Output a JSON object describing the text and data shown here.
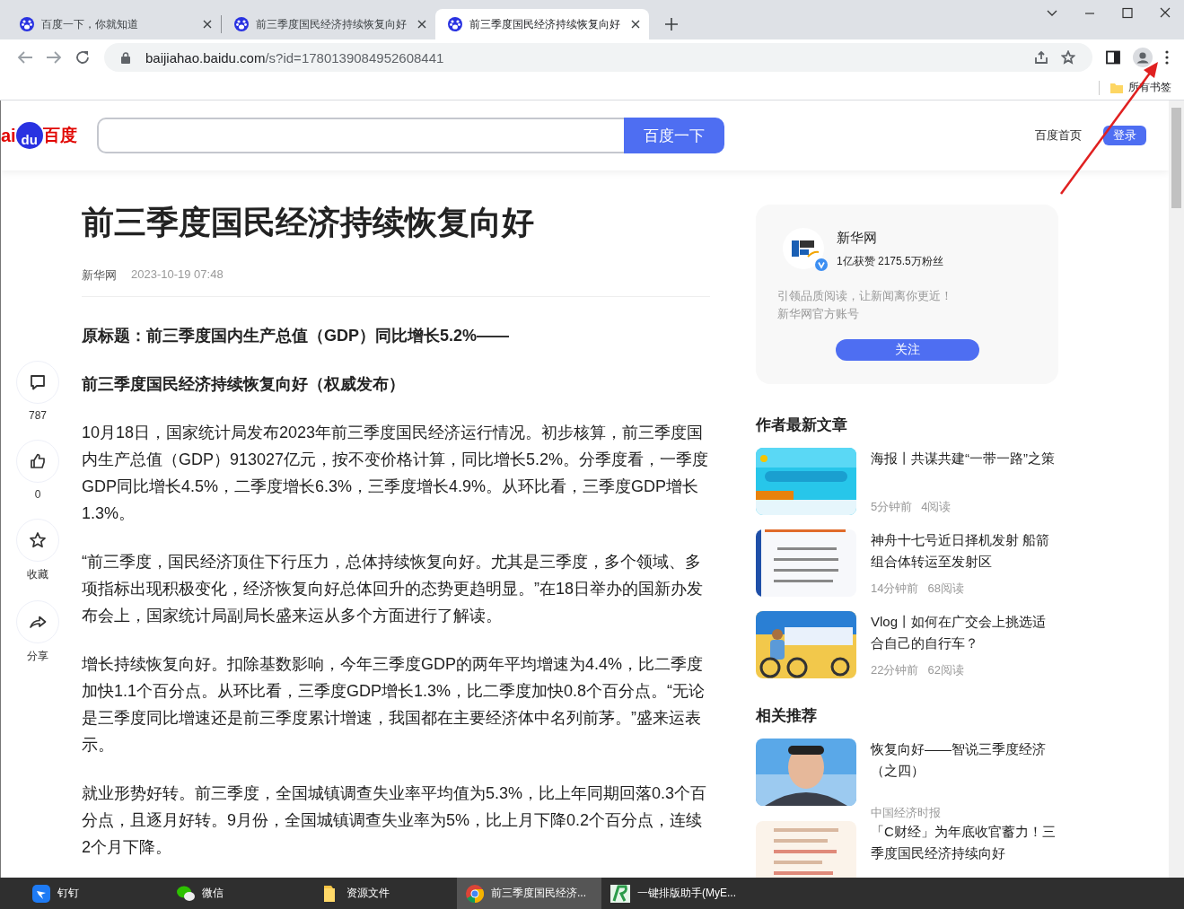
{
  "tabs": [
    {
      "title": "百度一下，你就知道",
      "selected": false
    },
    {
      "title": "前三季度国民经济持续恢复向好",
      "selected": false
    },
    {
      "title": "前三季度国民经济持续恢复向好",
      "selected": true
    }
  ],
  "address": {
    "host": "baijiahao.baidu.com",
    "path": "/s?id=1780139084952608441"
  },
  "bookmarks": {
    "label": "所有书签"
  },
  "header": {
    "logo": {
      "left": "ai",
      "paw": "du",
      "right": "百度"
    },
    "search_button": "百度一下",
    "home_link": "百度首页",
    "login_button": "登录"
  },
  "actions": [
    {
      "kind": "comment",
      "label": "787"
    },
    {
      "kind": "like",
      "label": "0"
    },
    {
      "kind": "favorite",
      "label": "收藏"
    },
    {
      "kind": "share",
      "label": "分享"
    }
  ],
  "article": {
    "title": "前三季度国民经济持续恢复向好",
    "source": "新华网",
    "date": "2023-10-19 07:48",
    "paragraphs": [
      {
        "kind": "heading",
        "text": "原标题：前三季度国内生产总值（GDP）同比增长5.2%——"
      },
      {
        "kind": "heading",
        "text": "前三季度国民经济持续恢复向好（权威发布）"
      },
      {
        "kind": "body",
        "text": "10月18日，国家统计局发布2023年前三季度国民经济运行情况。初步核算，前三季度国内生产总值（GDP）913027亿元，按不变价格计算，同比增长5.2%。分季度看，一季度GDP同比增长4.5%，二季度增长6.3%，三季度增长4.9%。从环比看，三季度GDP增长1.3%。"
      },
      {
        "kind": "body",
        "text": "“前三季度，国民经济顶住下行压力，总体持续恢复向好。尤其是三季度，多个领域、多项指标出现积极变化，经济恢复向好总体回升的态势更趋明显。”在18日举办的国新办发布会上，国家统计局副局长盛来运从多个方面进行了解读。"
      },
      {
        "kind": "body",
        "text": "增长持续恢复向好。扣除基数影响，今年三季度GDP的两年平均增速为4.4%，比二季度加快1.1个百分点。从环比看，三季度GDP增长1.3%，比二季度加快0.8个百分点。“无论是三季度同比增速还是前三季度累计增速，我国都在主要经济体中名列前茅。”盛来运表示。"
      },
      {
        "kind": "body",
        "text": "就业形势好转。前三季度，全国城镇调查失业率平均值为5.3%，比上年同期回落0.3个百分点，且逐月好转。9月份，全国城镇调查失业率为5%，比上月下降0.2个百分点，连续2个月下降。"
      }
    ]
  },
  "author": {
    "name": "新华网",
    "verified": true,
    "stats": "1亿获赞 2175.5万粉丝",
    "bio": [
      "引领品质阅读，让新闻离你更近！",
      "新华网官方账号"
    ],
    "follow_button": "关注"
  },
  "latest": {
    "heading": "作者最新文章",
    "items": [
      {
        "title": "海报丨共谋共建“一带一路”之策",
        "time": "5分钟前",
        "reads": "4阅读"
      },
      {
        "title": "神舟十七号近日择机发射 船箭组合体转运至发射区",
        "time": "14分钟前",
        "reads": "68阅读"
      },
      {
        "title": "Vlog丨如何在广交会上挑选适合自己的自行车？",
        "time": "22分钟前",
        "reads": "62阅读"
      }
    ]
  },
  "related": {
    "heading": "相关推荐",
    "items": [
      {
        "title": "恢复向好——智说三季度经济（之四）",
        "source": "中国经济时报"
      },
      {
        "title": "「C财经」为年底收官蓄力！三季度国民经济持续向好"
      }
    ]
  },
  "taskbar": [
    {
      "kind": "dingtalk",
      "label": "钉钉",
      "active": false
    },
    {
      "kind": "wechat",
      "label": "微信",
      "active": false
    },
    {
      "kind": "folder",
      "label": "资源文件",
      "active": false
    },
    {
      "kind": "chrome",
      "label": "前三季度国民经济...",
      "active": true
    },
    {
      "kind": "app",
      "label": "一键排版助手(MyE..."
    }
  ]
}
